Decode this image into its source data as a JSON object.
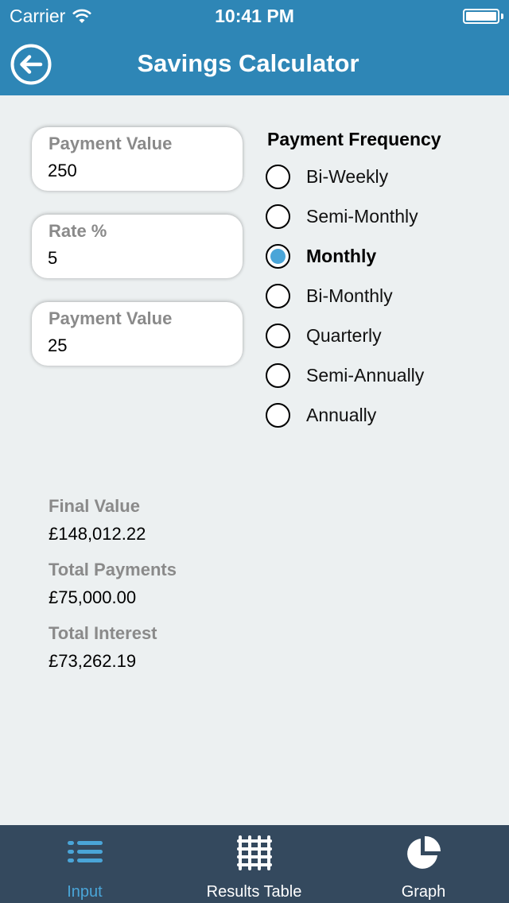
{
  "status_bar": {
    "carrier": "Carrier",
    "time": "10:41 PM",
    "battery_level": 1.0
  },
  "nav": {
    "title": "Savings Calculator",
    "back_icon": "circle-arrow-left-icon"
  },
  "inputs": [
    {
      "label": "Payment Value",
      "value": "250"
    },
    {
      "label": "Rate %",
      "value": "5"
    },
    {
      "label": "Payment Value",
      "value": "25"
    }
  ],
  "frequency": {
    "title": "Payment Frequency",
    "selected": "Monthly",
    "options": [
      {
        "label": "Bi-Weekly",
        "selected": false
      },
      {
        "label": "Semi-Monthly",
        "selected": false
      },
      {
        "label": "Monthly",
        "selected": true
      },
      {
        "label": "Bi-Monthly",
        "selected": false
      },
      {
        "label": "Quarterly",
        "selected": false
      },
      {
        "label": "Semi-Annually",
        "selected": false
      },
      {
        "label": "Annually",
        "selected": false
      }
    ]
  },
  "results": [
    {
      "label": "Final Value",
      "value": "£148,012.22"
    },
    {
      "label": "Total Payments",
      "value": "£75,000.00"
    },
    {
      "label": "Total Interest",
      "value": "£73,262.19"
    }
  ],
  "tabs": [
    {
      "label": "Input",
      "icon": "list-icon",
      "active": true
    },
    {
      "label": "Results Table",
      "icon": "grid-icon",
      "active": false
    },
    {
      "label": "Graph",
      "icon": "pie-chart-icon",
      "active": false
    }
  ],
  "colors": {
    "header": "#2e86b6",
    "accent": "#4aa5d8",
    "tab_bar": "#34495e",
    "background": "#ecf0f1"
  }
}
